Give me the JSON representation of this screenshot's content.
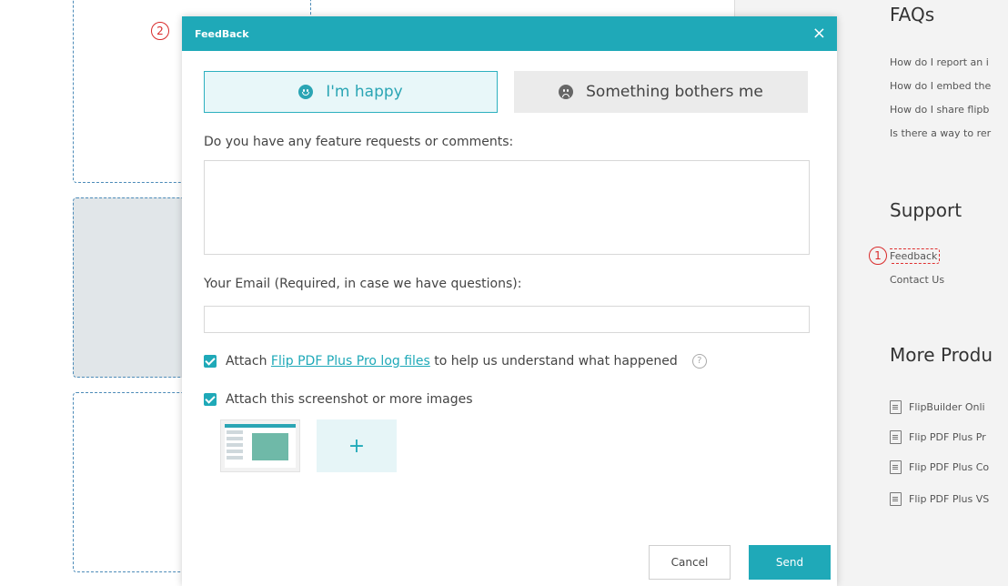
{
  "markers": {
    "one": "1",
    "two": "2"
  },
  "sidebar": {
    "faq_title": "FAQs",
    "faqs": [
      "How do I report an i",
      "How do I embed the",
      "How do I share flipb",
      "Is there a way to rer"
    ],
    "support_title": "Support",
    "support_links": [
      "Feedback",
      "Contact Us"
    ],
    "more_title": "More Produ",
    "products": [
      "FlipBuilder Onli",
      "Flip PDF Plus Pr",
      "Flip PDF Plus Co",
      "Flip PDF Plus VS"
    ]
  },
  "dialog": {
    "title": "FeedBack",
    "close_icon": "×",
    "happy_label": "I'm happy",
    "bother_label": "Something bothers me",
    "comments_label": "Do you have any feature requests or comments:",
    "comments_value": "",
    "email_label": "Your Email (Required, in case we have questions):",
    "email_value": "",
    "attach_logs_prefix": "Attach ",
    "attach_logs_link": "Flip PDF Plus Pro log files",
    "attach_logs_suffix": " to help us understand what happened",
    "help_icon": "?",
    "attach_logs_checked": true,
    "attach_screenshot_label": "Attach this screenshot or more images",
    "attach_screenshot_checked": true,
    "add_image_icon": "+",
    "cancel_label": "Cancel",
    "send_label": "Send"
  },
  "colors": {
    "accent": "#1fa9b8",
    "marker": "#d92b2b"
  }
}
